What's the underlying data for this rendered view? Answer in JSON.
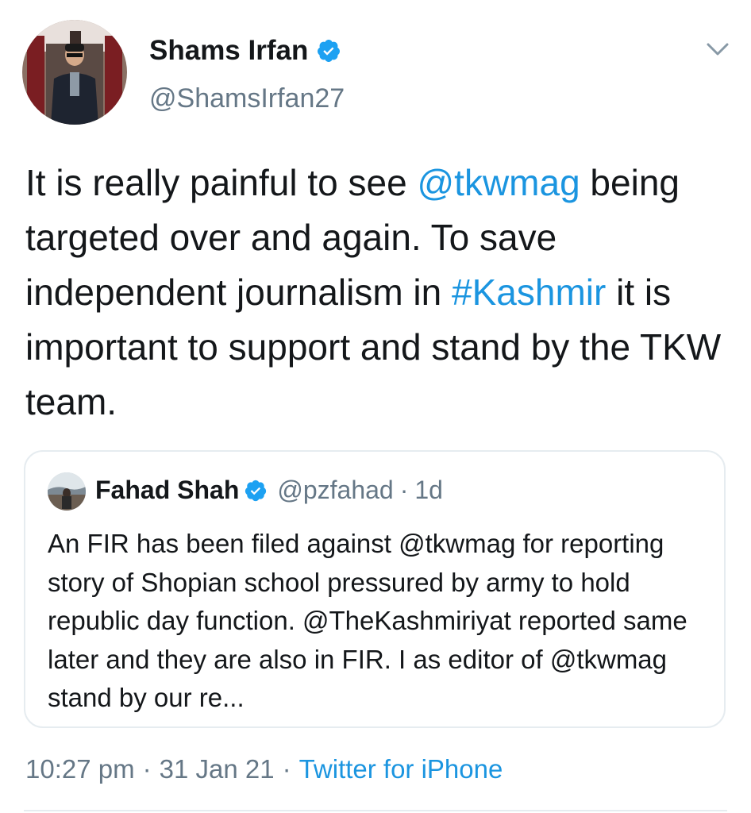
{
  "author": {
    "name": "Shams Irfan",
    "handle": "@ShamsIrfan27",
    "verified": true
  },
  "tweet": {
    "parts": [
      {
        "text": "It is really painful to see ",
        "link": false
      },
      {
        "text": "@tkwmag",
        "link": true
      },
      {
        "text": " being targeted over and again. To save independent journalism in ",
        "link": false
      },
      {
        "text": "#Kashmir",
        "link": true
      },
      {
        "text": " it is important to support and stand by the TKW team.",
        "link": false
      }
    ]
  },
  "quoted": {
    "name": "Fahad Shah",
    "handle": "@pzfahad",
    "separator": "·",
    "time": "1d",
    "text": "An FIR has been filed against @tkwmag for reporting story of Shopian school pressured by army to hold republic day function. @TheKashmiriyat reported same later and they are also in FIR. I as editor of @tkwmag stand by our re..."
  },
  "meta": {
    "time": "10:27 pm",
    "separator": "·",
    "date": "31 Jan 21",
    "source": "Twitter for iPhone"
  },
  "colors": {
    "link": "#1b95e0",
    "muted": "#657786",
    "text": "#14171a",
    "border": "#e6ecf0"
  },
  "icons": [
    "verified-badge-icon",
    "chevron-down-icon"
  ]
}
